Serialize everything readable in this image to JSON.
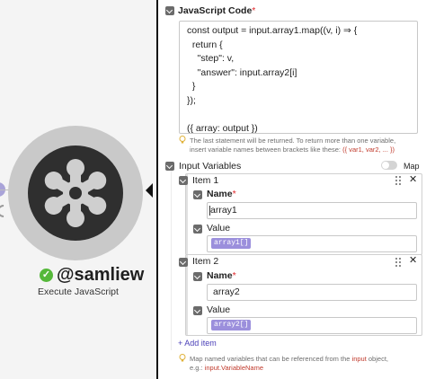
{
  "module": {
    "username": "@samliew",
    "label": "Execute JavaScript"
  },
  "code_section": {
    "title": "JavaScript Code",
    "code": "const output = input.array1.map((v, i) ⇒ {\n  return {\n    \"step\": v,\n    \"answer\": input.array2[i]\n  }\n});\n\n({ array: output })",
    "hint_line1": "The last statement will be returned. To return more than one variable,",
    "hint_line2": "insert variable names between brackets like these:",
    "hint_example": "({ var1, var2, ... })"
  },
  "input_variables": {
    "title": "Input Variables",
    "map_label": "Map",
    "items": [
      {
        "title": "Item 1",
        "name_label": "Name",
        "name_value": "array1",
        "value_label": "Value",
        "value_chip": "array1[]"
      },
      {
        "title": "Item 2",
        "name_label": "Name",
        "name_value": "array2",
        "value_label": "Value",
        "value_chip": "array2[]"
      }
    ],
    "add_item_label": "+ Add item",
    "hint_line1_before": "Map named variables that can be referenced from the",
    "hint_line1_code": "input",
    "hint_line1_after": "object,",
    "hint_line2_before": "e.g.:",
    "hint_line2_code": "input.VariableName"
  },
  "colors": {
    "accent_purple": "#9b8fdc",
    "verified_green": "#55b83a",
    "required_red": "#e0262a"
  }
}
